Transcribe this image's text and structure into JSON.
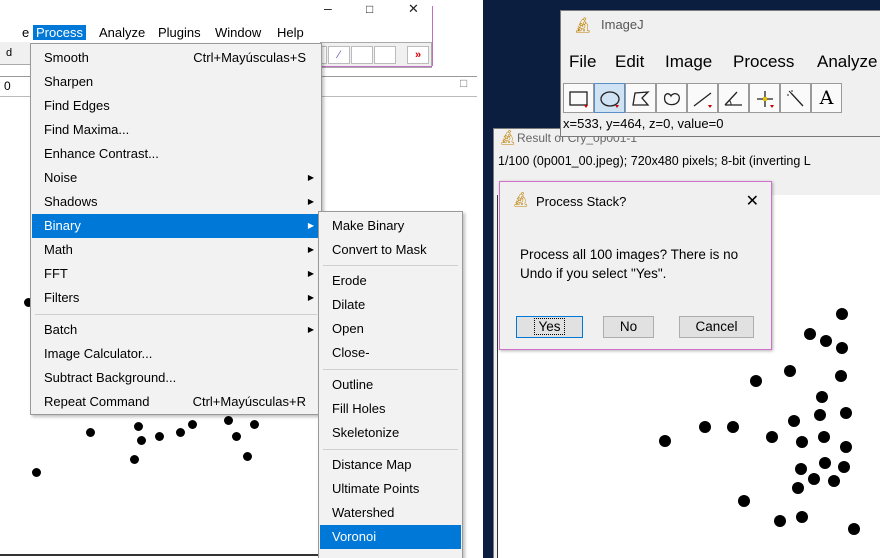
{
  "left": {
    "window_controls": [
      "–",
      "□",
      "✕"
    ],
    "menubar": {
      "partial": "e",
      "items": [
        "Process",
        "Analyze",
        "Plugins",
        "Window",
        "Help"
      ],
      "selected": "Process"
    },
    "left_edge_labels": [
      "d",
      "0"
    ],
    "toolbar_more": "»",
    "process_menu": [
      {
        "label": "Smooth",
        "shortcut": "Ctrl+Mayúsculas+S"
      },
      {
        "label": "Sharpen"
      },
      {
        "label": "Find Edges"
      },
      {
        "label": "Find Maxima..."
      },
      {
        "label": "Enhance Contrast..."
      },
      {
        "label": "Noise",
        "submenu": true
      },
      {
        "label": "Shadows",
        "submenu": true
      },
      {
        "label": "Binary",
        "submenu": true,
        "highlighted": true
      },
      {
        "label": "Math",
        "submenu": true
      },
      {
        "label": "FFT",
        "submenu": true
      },
      {
        "label": "Filters",
        "submenu": true
      },
      {
        "label": "Batch",
        "submenu": true
      },
      {
        "label": "Image Calculator..."
      },
      {
        "label": "Subtract Background..."
      },
      {
        "label": "Repeat Command",
        "shortcut": "Ctrl+Mayúsculas+R"
      }
    ],
    "binary_menu": [
      {
        "label": "Make Binary"
      },
      {
        "label": "Convert to Mask"
      },
      {
        "label": "Erode"
      },
      {
        "label": "Dilate"
      },
      {
        "label": "Open"
      },
      {
        "label": "Close-"
      },
      {
        "label": "Outline"
      },
      {
        "label": "Fill Holes"
      },
      {
        "label": "Skeletonize"
      },
      {
        "label": "Distance Map"
      },
      {
        "label": "Ultimate Points"
      },
      {
        "label": "Watershed"
      },
      {
        "label": "Voronoi",
        "highlighted": true
      }
    ]
  },
  "right": {
    "imagej": {
      "title": "ImageJ",
      "menu": [
        "File",
        "Edit",
        "Image",
        "Process",
        "Analyze"
      ],
      "tools": [
        "rectangle-tool",
        "oval-tool",
        "polygon-tool",
        "freehand-tool",
        "line-tool",
        "angle-tool",
        "point-tool",
        "wand-tool",
        "text-tool"
      ],
      "text_tool_glyph": "A",
      "status": "x=533, y=464, z=0, value=0"
    },
    "result_window": {
      "title": "Result of Cry_0p001-1",
      "info": "1/100 (0p001_00.jpeg); 720x480 pixels; 8-bit (inverting L"
    },
    "dialog": {
      "title": "Process Stack?",
      "close": "✕",
      "message": "Process all 100 images? There is no Undo if you select \"Yes\".",
      "buttons": {
        "yes": "Yes",
        "no": "No",
        "cancel": "Cancel"
      }
    }
  },
  "colors": {
    "highlight": "#0078d7",
    "dialog_border": "#d070c8",
    "desktop": "#0b1e3f",
    "menu_bg": "#f2f2f2"
  }
}
